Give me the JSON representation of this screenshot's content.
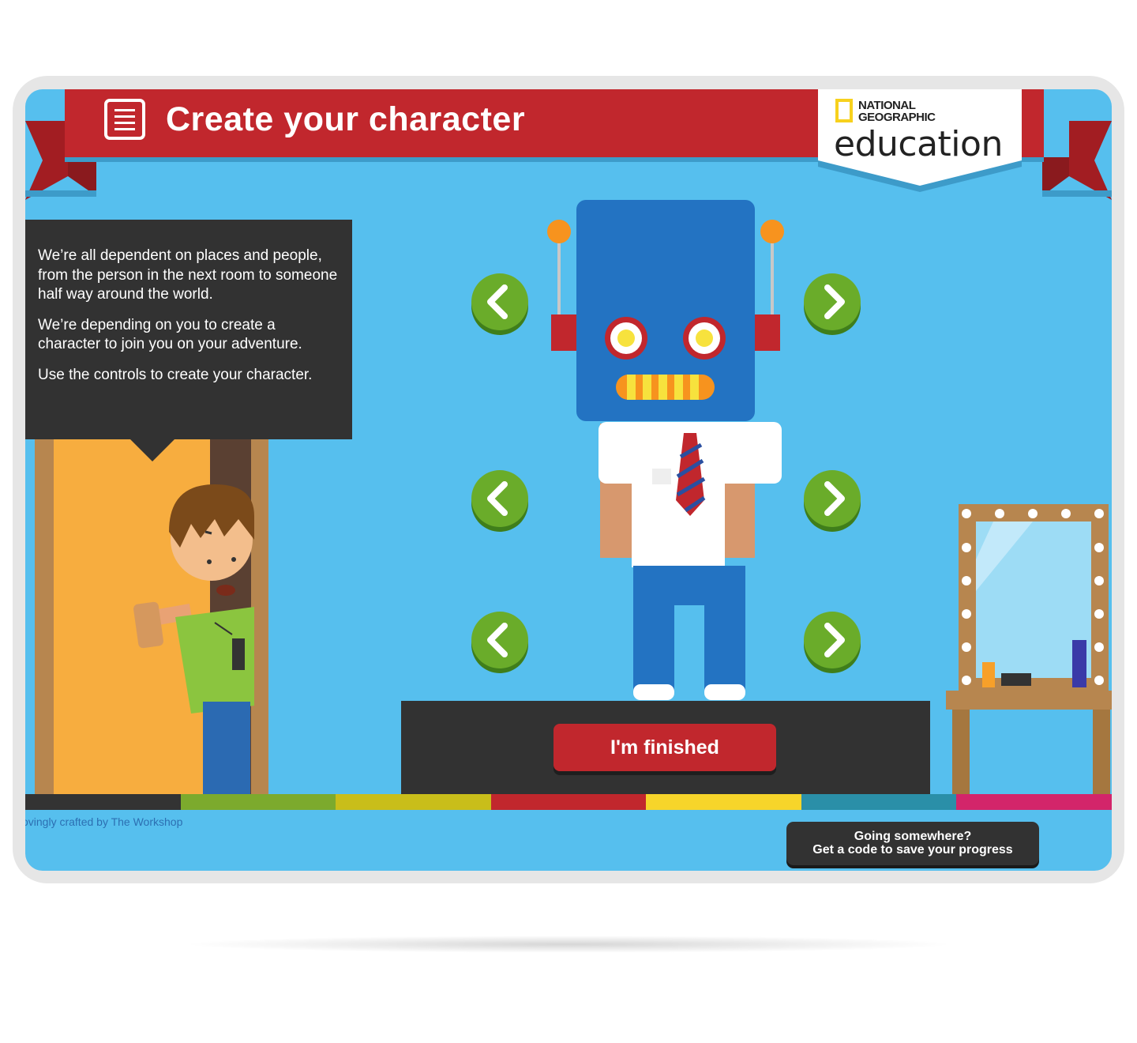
{
  "header": {
    "title": "Create your character",
    "menu_icon": "document-menu-icon"
  },
  "logo": {
    "line1": "NATIONAL",
    "line2": "GEOGRAPHIC",
    "wordmark": "education"
  },
  "info": {
    "paragraphs": [
      "We’re all dependent on places and people, from the person in the next room to someone half way around the world.",
      "We’re depending on you to create a character to join you on your adventure.",
      "Use the controls to create your character."
    ]
  },
  "controls": {
    "finish_label": "I'm finished",
    "prev_icon": "chevron-left-icon",
    "next_icon": "chevron-right-icon"
  },
  "footer": {
    "credit": "ovingly crafted by The Workshop",
    "save_line1": "Going somewhere?",
    "save_line2": "Get a code to save your progress"
  },
  "colors": {
    "background": "#56bfee",
    "ribbon": "#c1272d",
    "dark_panel": "#323232",
    "arrow_green": "#6aac2a",
    "strip": [
      "#333333",
      "#7caa2d",
      "#c9be1a",
      "#c1272d",
      "#f7d52a",
      "#2a8fa8",
      "#d3256a"
    ]
  }
}
